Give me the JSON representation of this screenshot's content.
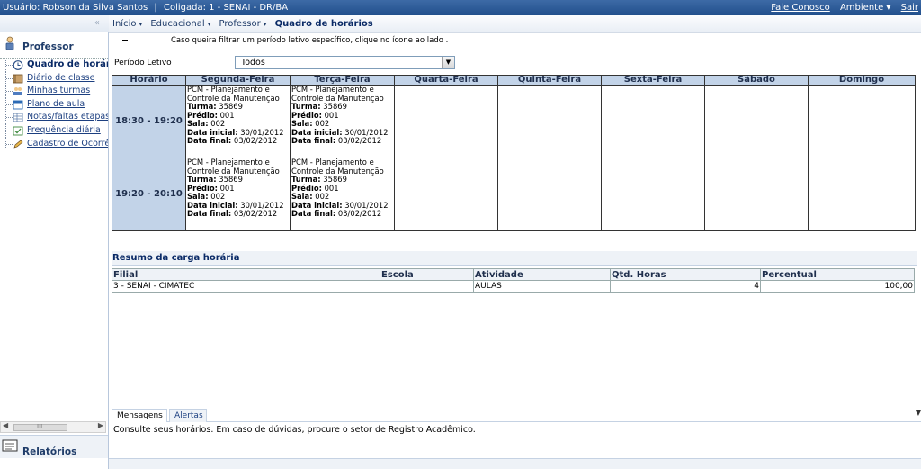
{
  "topbar": {
    "user": "Usuário: Robson da Silva Santos",
    "separator": "|",
    "coligada": "Coligada: 1 - SENAI - DR/BA",
    "fale_conosco": "Fale Conosco",
    "ambiente": "Ambiente ▾",
    "sair": "Sair"
  },
  "sidebar": {
    "collapse_icon": "«",
    "section_title": "Professor",
    "items": [
      {
        "label": "Quadro de horári",
        "icon": "clock-icon",
        "active": true
      },
      {
        "label": "Diário de classe",
        "icon": "book-icon"
      },
      {
        "label": "Minhas turmas",
        "icon": "group-icon"
      },
      {
        "label": "Plano de aula",
        "icon": "calendar-icon"
      },
      {
        "label": "Notas/faltas etapas",
        "icon": "grid-icon"
      },
      {
        "label": "Frequência diária",
        "icon": "check-icon"
      },
      {
        "label": "Cadastro de Ocorrê",
        "icon": "pen-icon"
      }
    ],
    "relatorios": "Relatórios"
  },
  "breadcrumb": {
    "inicio": "Início",
    "educacional": "Educacional",
    "professor": "Professor",
    "current": "Quadro de horários",
    "dropdown_glyph": "▾"
  },
  "hint": "Caso queira filtrar um período letivo específico, clique no ícone ao lado .",
  "periodo": {
    "label": "Período Letivo",
    "value": "Todos"
  },
  "schedule": {
    "headers": [
      "Horário",
      "Segunda-Feira",
      "Terça-Feira",
      "Quarta-Feira",
      "Quinta-Feira",
      "Sexta-Feira",
      "Sábado",
      "Domingo"
    ],
    "rows": [
      {
        "time": "18:30 - 19:20",
        "entries": [
          {
            "course1": "PCM - Planejamento e",
            "course2": "Controle da Manutenção",
            "turma": "35869",
            "predio": "001",
            "sala": "002",
            "inicio": "30/01/2012",
            "fim": "03/02/2012"
          },
          {
            "course1": "PCM - Planejamento e",
            "course2": "Controle da Manutenção",
            "turma": "35869",
            "predio": "001",
            "sala": "002",
            "inicio": "30/01/2012",
            "fim": "03/02/2012"
          }
        ]
      },
      {
        "time": "19:20 - 20:10",
        "entries": [
          {
            "course1": "PCM - Planejamento e",
            "course2": "Controle da Manutenção",
            "turma": "35869",
            "predio": "001",
            "sala": "002",
            "inicio": "30/01/2012",
            "fim": "03/02/2012"
          },
          {
            "course1": "PCM - Planejamento e",
            "course2": "Controle da Manutenção",
            "turma": "35869",
            "predio": "001",
            "sala": "002",
            "inicio": "30/01/2012",
            "fim": "03/02/2012"
          }
        ]
      }
    ],
    "labels": {
      "turma": "Turma:",
      "predio": "Prédio:",
      "sala": "Sala:",
      "inicio": "Data inicial:",
      "fim": "Data final:"
    }
  },
  "resumo": {
    "title": "Resumo da carga horária",
    "headers": [
      "Filial",
      "Escola",
      "Atividade",
      "Qtd. Horas",
      "Percentual"
    ],
    "rows": [
      [
        "3 - SENAI - CIMATEC",
        "",
        "AULAS",
        "4",
        "100,00"
      ]
    ]
  },
  "messages": {
    "tab_mensagens": "Mensagens",
    "tab_alertas": "Alertas",
    "text": "Consulte seus horários. Em caso de dúvidas, procure o setor de Registro Acadêmico."
  }
}
